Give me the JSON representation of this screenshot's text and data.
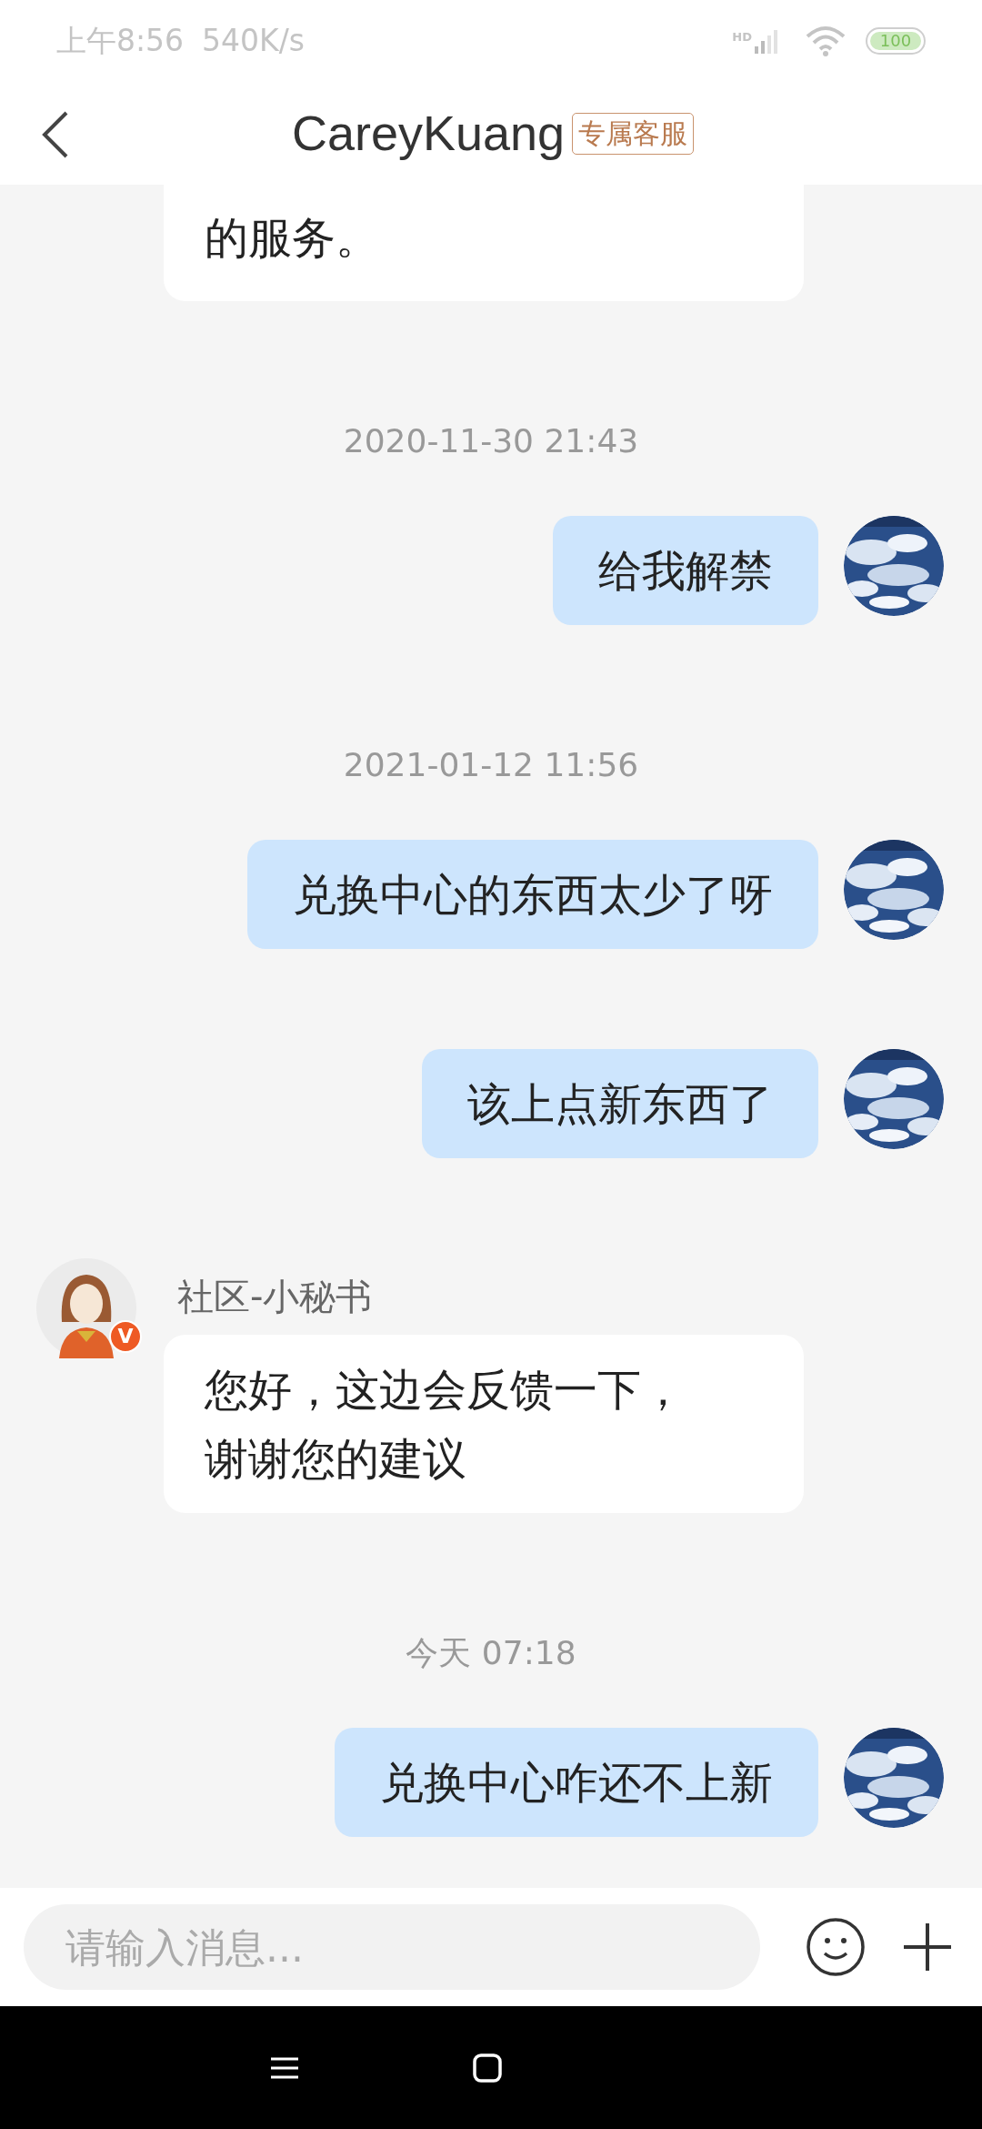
{
  "status_bar": {
    "time": "上午8:56",
    "speed": "540K/s",
    "network": "HD",
    "battery": "100"
  },
  "header": {
    "title": "CareyKuang",
    "tag": "专属客服"
  },
  "messages": [
    {
      "kind": "incoming",
      "cut": true,
      "lines": [
        "的服务。"
      ]
    },
    {
      "kind": "timestamp",
      "text": "2020-11-30 21:43"
    },
    {
      "kind": "outgoing",
      "lines": [
        "给我解禁"
      ]
    },
    {
      "kind": "timestamp",
      "text": "2021-01-12 11:56"
    },
    {
      "kind": "outgoing",
      "lines": [
        "兑换中心的东西太少了呀"
      ]
    },
    {
      "kind": "outgoing",
      "lines": [
        "该上点新东西了"
      ]
    },
    {
      "kind": "incoming",
      "sender": "社区-小秘书",
      "badge": "V",
      "lines": [
        "您好，这边会反馈一下，",
        "谢谢您的建议"
      ]
    },
    {
      "kind": "timestamp",
      "text": "今天 07:18"
    },
    {
      "kind": "outgoing",
      "lines": [
        "兑换中心咋还不上新"
      ]
    }
  ],
  "input": {
    "placeholder": "请输入消息..."
  }
}
